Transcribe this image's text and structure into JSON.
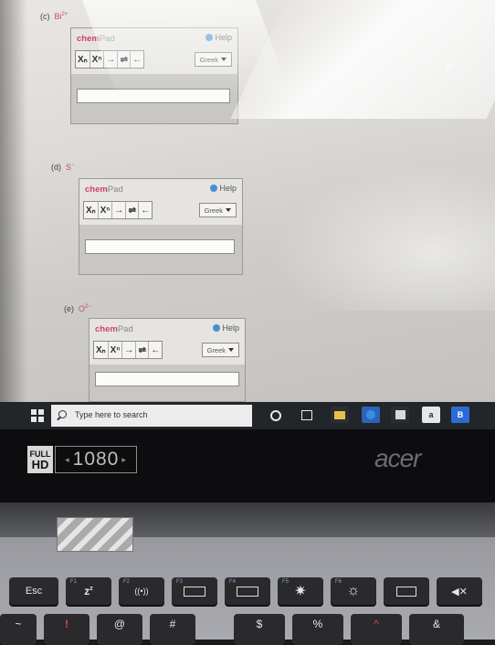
{
  "questions": [
    {
      "label": "(c)",
      "species": "Bi",
      "charge": "2+"
    },
    {
      "label": "(d)",
      "species": "S",
      "charge": "−"
    },
    {
      "label": "(e)",
      "species": "O",
      "charge": "2−"
    }
  ],
  "chempad": {
    "title_chem": "chem",
    "title_pad": "Pad",
    "help": "Help",
    "greek": "Greek",
    "tools": [
      "Xₙ",
      "Xⁿ",
      "→",
      "⇌",
      "←"
    ]
  },
  "taskbar": {
    "search_placeholder": "Type here to search",
    "apps": [
      {
        "name": "amazon",
        "label": "a",
        "color": "#232f3e"
      },
      {
        "name": "b-app",
        "label": "B",
        "color": "#2b6cd4"
      }
    ]
  },
  "bezel": {
    "full": "FULL",
    "hd": "HD",
    "resolution": "1080",
    "brand": "acer"
  },
  "keyboard": {
    "esc": "Esc",
    "fn_labels": [
      "F1",
      "F2",
      "F3",
      "F4",
      "F5",
      "F6"
    ],
    "number_row": [
      "~",
      "!",
      "@",
      "#",
      "$",
      "%",
      "^",
      "&"
    ]
  },
  "colors": {
    "accent_pink": "#d0426a",
    "taskbar": "#222529",
    "help_blue": "#4a8ed0"
  }
}
